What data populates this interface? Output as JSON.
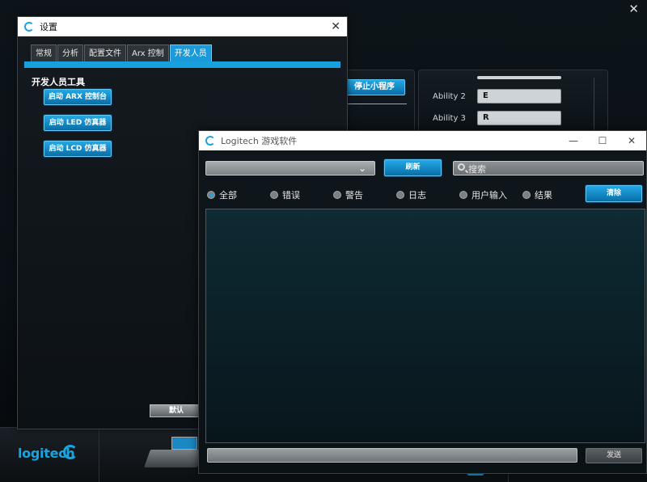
{
  "background": {
    "close_glyph": "✕",
    "stop_button": "停止小程序",
    "abilities": [
      {
        "label": "Ability 2",
        "value": "E"
      },
      {
        "label": "Ability 3",
        "value": "R"
      }
    ],
    "logo_text": "logitech"
  },
  "settings": {
    "title": "设置",
    "close_glyph": "✕",
    "tabs": [
      {
        "label": "常规",
        "active": false
      },
      {
        "label": "分析",
        "active": false
      },
      {
        "label": "配置文件",
        "active": false
      },
      {
        "label": "Arx 控制",
        "active": false
      },
      {
        "label": "开发人员",
        "active": true
      }
    ],
    "section_title": "开发人员工具",
    "buttons": [
      "启动 ARX 控制台",
      "启动 LED 仿真器",
      "启动 LCD 仿真器"
    ],
    "default_button": "默认"
  },
  "console": {
    "title": "Logitech 游戏软件",
    "controls": {
      "minimize": "—",
      "maximize": "☐",
      "close": "✕"
    },
    "dropdown_arrow": "⌄",
    "refresh_button": "刷新",
    "search_placeholder": "搜索",
    "filters": [
      {
        "label": "全部",
        "selected": true
      },
      {
        "label": "错误",
        "selected": false
      },
      {
        "label": "警告",
        "selected": false
      },
      {
        "label": "日志",
        "selected": false
      },
      {
        "label": "用户输入",
        "selected": false
      },
      {
        "label": "结果",
        "selected": false
      }
    ],
    "clear_button": "清除",
    "send_button": "发送"
  },
  "colors": {
    "accent": "#18a4e0",
    "title_bar": "#ffffff"
  }
}
